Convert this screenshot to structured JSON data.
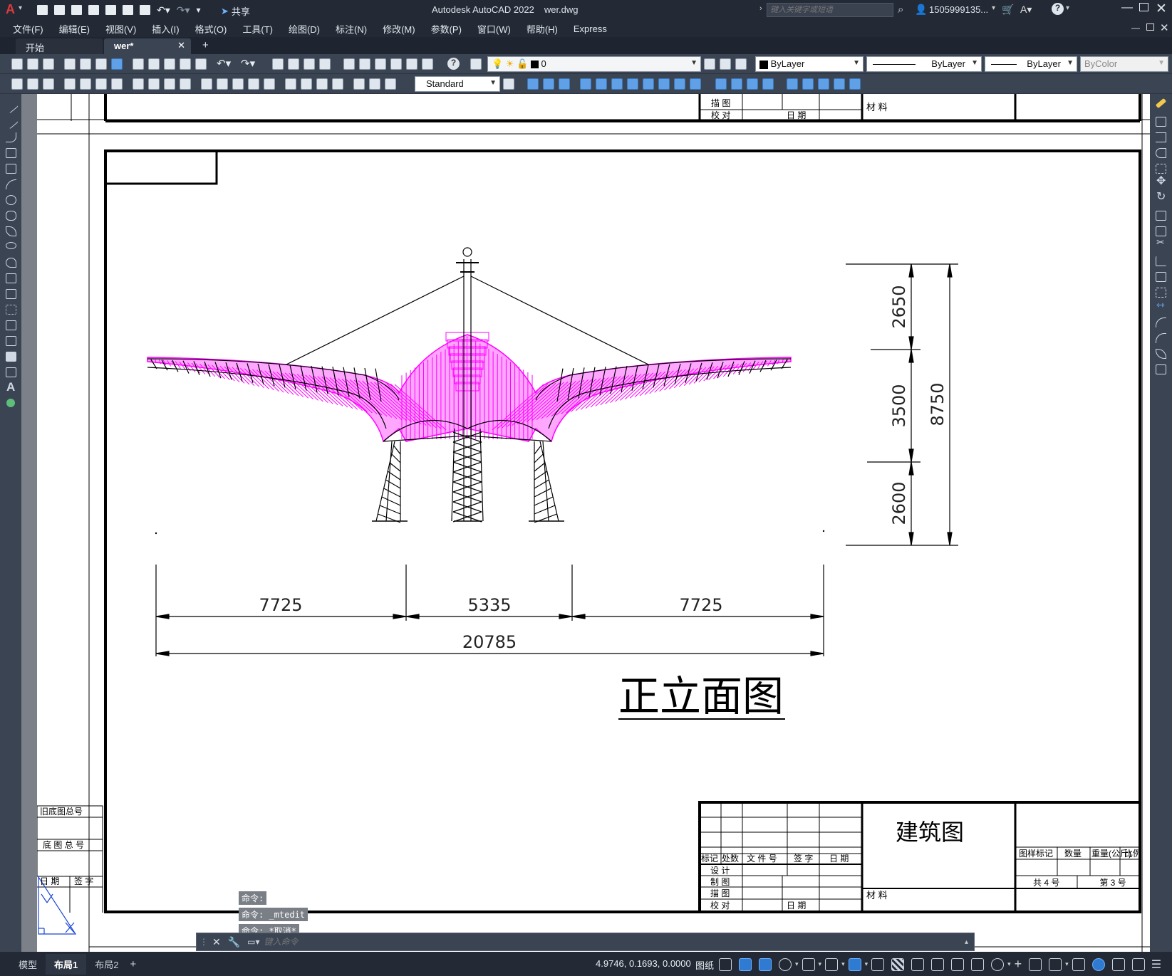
{
  "title_bar": {
    "app_title": "Autodesk AutoCAD 2022",
    "file_name": "wer.dwg",
    "share_label": "共享",
    "search_placeholder": "键入关键字或短语",
    "user_name": "1505999135...",
    "window_controls": [
      "minimize-icon",
      "maximize-icon",
      "close-icon"
    ]
  },
  "menu_bar": [
    "文件(F)",
    "编辑(E)",
    "视图(V)",
    "插入(I)",
    "格式(O)",
    "工具(T)",
    "绘图(D)",
    "标注(N)",
    "修改(M)",
    "参数(P)",
    "窗口(W)",
    "帮助(H)",
    "Express"
  ],
  "doc_tabs": [
    {
      "label": "开始",
      "active": false
    },
    {
      "label": "wer*",
      "active": true
    }
  ],
  "properties": {
    "layer_value": "0",
    "color_value": "ByLayer",
    "linetype_value": "ByLayer",
    "lineweight_value": "ByLayer",
    "plotstyle_value": "ByColor",
    "text_style": "Standard"
  },
  "drawing": {
    "title": "正立面图",
    "dimensions_horizontal": [
      "7725",
      "5335",
      "7725",
      "20785"
    ],
    "dimensions_vertical": [
      "2650",
      "3500",
      "2600",
      "8750"
    ],
    "title_block": {
      "name": "建筑图",
      "material_label": "材 料",
      "revision_headers": [
        "标记",
        "处数",
        "文 件 号",
        "签 字",
        "日 期"
      ],
      "roles": [
        "设 计",
        "制 图",
        "描 图",
        "校 对"
      ],
      "date_label": "日 期",
      "right_headers": [
        "图样标记",
        "数量",
        "重量(公斤)",
        "比例"
      ],
      "sheet_total": "共  4  号",
      "sheet_no": "第  3  号",
      "top_roles": [
        "描 图",
        "校 对"
      ]
    },
    "left_strip": {
      "old_base_no": "旧底图总号",
      "base_no": "底 图 总 号",
      "date": "日 期",
      "sign": "签 字"
    },
    "colors": {
      "roof": "#ff00ff",
      "structure": "#000000"
    }
  },
  "command": {
    "history": [
      "命令:",
      "命令: _mtedit",
      "命令: *取消*"
    ],
    "placeholder": "键入命令"
  },
  "status_bar": {
    "layout_tabs": [
      "模型",
      "布局1",
      "布局2"
    ],
    "active_layout": "布局1",
    "coordinates": "4.9746, 0.1693, 0.0000",
    "space_label": "图纸"
  }
}
